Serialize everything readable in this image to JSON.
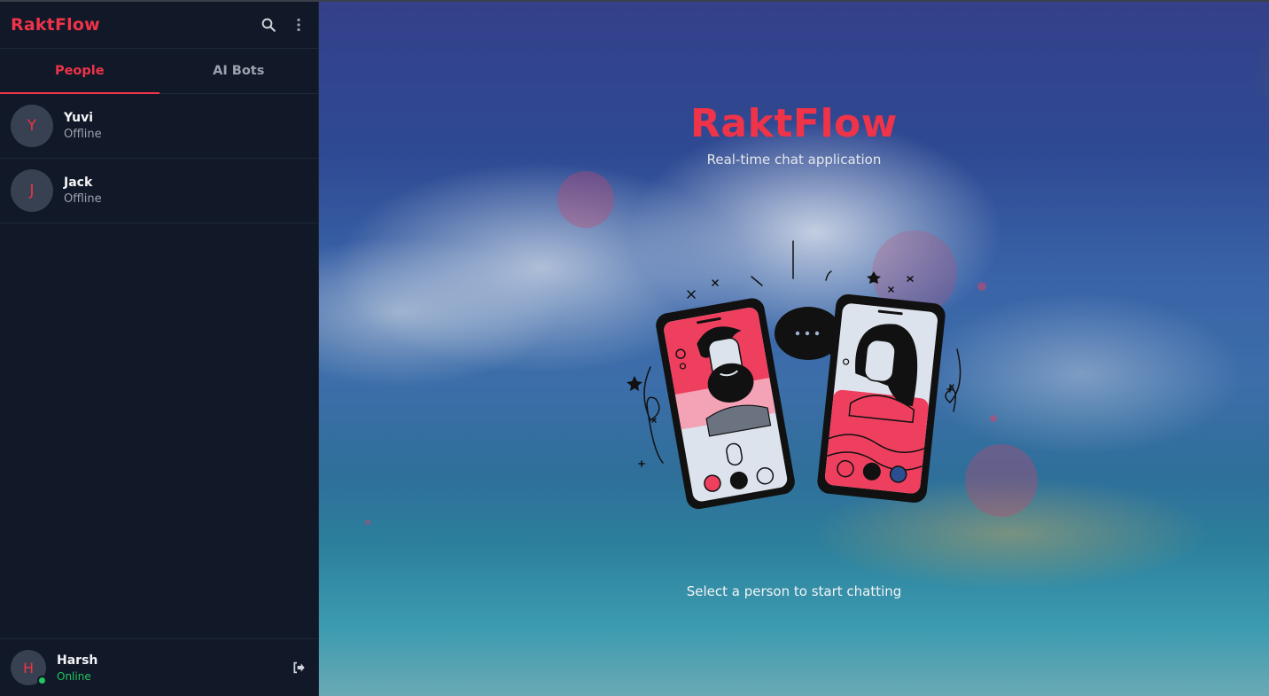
{
  "sidebar": {
    "brand": "RaktFlow",
    "tabs": [
      {
        "label": "People",
        "active": true
      },
      {
        "label": "AI Bots",
        "active": false
      }
    ],
    "contacts": [
      {
        "initial": "Y",
        "name": "Yuvi",
        "status": "Offline"
      },
      {
        "initial": "J",
        "name": "Jack",
        "status": "Offline"
      }
    ],
    "current_user": {
      "initial": "H",
      "name": "Harsh",
      "status": "Online"
    }
  },
  "main": {
    "title": "RaktFlow",
    "subtitle": "Real-time chat application",
    "prompt": "Select a person to start chatting"
  },
  "colors": {
    "accent": "#ef3349",
    "sidebar_bg": "#111827",
    "online": "#22c55e",
    "muted_text": "#9ca3af"
  },
  "icons": [
    "search-icon",
    "more-vertical-icon",
    "logout-icon",
    "video-icon",
    "speaker-icon"
  ]
}
